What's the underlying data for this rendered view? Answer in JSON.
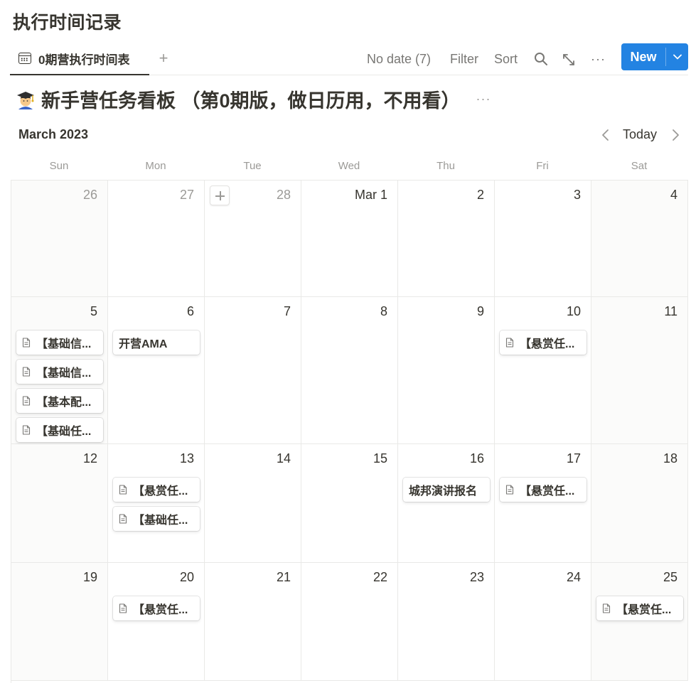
{
  "page": {
    "title": "执行时间记录"
  },
  "view": {
    "tab_label": "0期营执行时间表",
    "add_view": "+",
    "no_date": "No date (7)",
    "filter": "Filter",
    "sort": "Sort",
    "more": "···",
    "new_label": "New"
  },
  "database": {
    "title": "新手营任务看板 （第0期版，做日历用，不用看）",
    "more": "···"
  },
  "calendar": {
    "month": "March 2023",
    "today": "Today",
    "weekdays": [
      "Sun",
      "Mon",
      "Tue",
      "Wed",
      "Thu",
      "Fri",
      "Sat"
    ],
    "weeks": [
      [
        {
          "day": "26",
          "dim": true,
          "events": []
        },
        {
          "day": "27",
          "dim": true,
          "events": []
        },
        {
          "day": "28",
          "dim": true,
          "add": true,
          "events": []
        },
        {
          "day": "Mar 1",
          "events": []
        },
        {
          "day": "2",
          "events": []
        },
        {
          "day": "3",
          "events": []
        },
        {
          "day": "4",
          "events": []
        }
      ],
      [
        {
          "day": "5",
          "events": [
            {
              "label": "【基础信...",
              "icon": true
            },
            {
              "label": "【基础信...",
              "icon": true
            },
            {
              "label": "【基本配...",
              "icon": true
            },
            {
              "label": "【基础任...",
              "icon": true
            }
          ]
        },
        {
          "day": "6",
          "events": [
            {
              "label": "开营AMA",
              "icon": false
            }
          ]
        },
        {
          "day": "7",
          "events": []
        },
        {
          "day": "8",
          "events": []
        },
        {
          "day": "9",
          "events": []
        },
        {
          "day": "10",
          "events": [
            {
              "label": "【悬赏任...",
              "icon": true
            }
          ]
        },
        {
          "day": "11",
          "events": []
        }
      ],
      [
        {
          "day": "12",
          "events": []
        },
        {
          "day": "13",
          "events": [
            {
              "label": "【悬赏任...",
              "icon": true
            },
            {
              "label": "【基础任...",
              "icon": true
            }
          ]
        },
        {
          "day": "14",
          "events": []
        },
        {
          "day": "15",
          "events": []
        },
        {
          "day": "16",
          "events": [
            {
              "label": "城邦演讲报名",
              "icon": false
            }
          ]
        },
        {
          "day": "17",
          "events": [
            {
              "label": "【悬赏任...",
              "icon": true
            }
          ]
        },
        {
          "day": "18",
          "events": []
        }
      ],
      [
        {
          "day": "19",
          "events": []
        },
        {
          "day": "20",
          "events": [
            {
              "label": "【悬赏任...",
              "icon": true
            }
          ]
        },
        {
          "day": "21",
          "events": []
        },
        {
          "day": "22",
          "events": []
        },
        {
          "day": "23",
          "events": []
        },
        {
          "day": "24",
          "events": []
        },
        {
          "day": "25",
          "events": [
            {
              "label": "【悬赏任...",
              "icon": true
            }
          ]
        }
      ]
    ]
  },
  "colors": {
    "accent": "#2383e2",
    "text": "#37352f",
    "muted": "#9b9a97",
    "grid": "#e9e9e7",
    "weekend": "#fbfbfa"
  }
}
